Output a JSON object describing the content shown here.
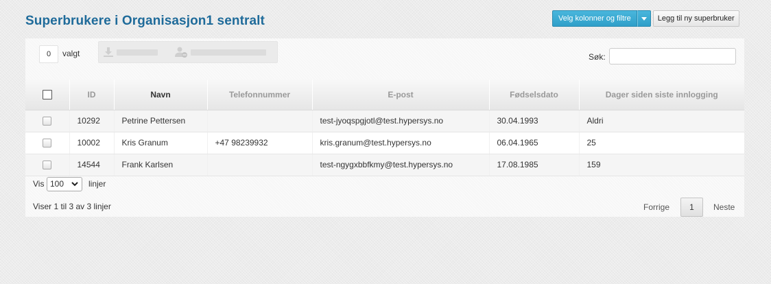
{
  "page": {
    "title": "Superbrukere i Organisasjon1 sentralt"
  },
  "header_actions": {
    "columns_filters_label": "Velg kolonner og filtre",
    "add_superuser_label": "Legg til ny superbruker"
  },
  "selection": {
    "count": "0",
    "label": "valgt"
  },
  "search": {
    "label": "Søk:",
    "value": "",
    "placeholder": ""
  },
  "table": {
    "columns": [
      "",
      "ID",
      "Navn",
      "Telefonnummer",
      "E-post",
      "Fødselsdato",
      "Dager siden siste innlogging"
    ],
    "sorted_column": "Navn",
    "rows": [
      {
        "id": "10292",
        "name": "Petrine Pettersen",
        "phone": "",
        "email": "test-jyoqspgjotl@test.hypersys.no",
        "birthdate": "30.04.1993",
        "days_since_login": "Aldri"
      },
      {
        "id": "10002",
        "name": "Kris Granum",
        "phone": "+47 98239932",
        "email": "kris.granum@test.hypersys.no",
        "birthdate": "06.04.1965",
        "days_since_login": "25"
      },
      {
        "id": "14544",
        "name": "Frank Karlsen",
        "phone": "",
        "email": "test-ngygxbbfkmy@test.hypersys.no",
        "birthdate": "17.08.1985",
        "days_since_login": "159"
      }
    ]
  },
  "length_menu": {
    "prefix": "Vis",
    "value": "100",
    "suffix": "linjer"
  },
  "info": "Viser 1 til 3 av 3 linjer",
  "pagination": {
    "previous": "Forrige",
    "current_page": "1",
    "next": "Neste"
  },
  "colors": {
    "title": "#1f6b9a",
    "primary_button": "#2f9fc9"
  },
  "icons": {
    "download": "download-icon",
    "remove_user": "user-remove-icon"
  }
}
